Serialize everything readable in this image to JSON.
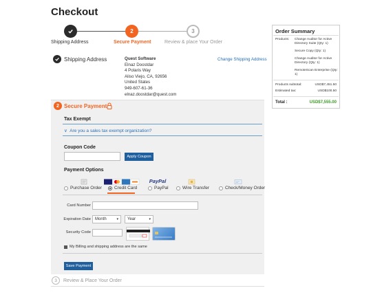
{
  "page_title": "Checkout",
  "stepper": {
    "step1_label": "Shipping Address",
    "step2_num": "2",
    "step2_label": "Secure Payment",
    "step3_num": "3",
    "step3_label": "Review & place Your Order"
  },
  "shipping": {
    "title": "Shipping Address",
    "company": "Quest Software",
    "name": "Elnaz Doostdar",
    "street": "4 Polaris Way",
    "city": "Aliso Viejo, CA, 92656",
    "country": "United States",
    "phone": "949-607-61-36",
    "email": "elnaz.doostdar@quest.com",
    "change_link": "Change Shipping Address"
  },
  "payment": {
    "num": "2",
    "title": "Secure Payment",
    "tax_exempt_heading": "Tax Exempt",
    "tax_exempt_question": "Are you a sales tax exempt organization?",
    "coupon_heading": "Coupon Code",
    "apply_coupon": "Apply Coupon",
    "options_heading": "Payment Options",
    "options": [
      "Purchase Order",
      "Credit Card",
      "PayPal",
      "Wire Transfer",
      "Check/Money Order"
    ],
    "selected_option": "Credit Card",
    "paypal_logo": "PayPal",
    "card_number_label": "Card Number",
    "expiration_label": "Expiration Date",
    "month_value": "Month",
    "year_value": "Year",
    "security_code_label": "Security Code",
    "same_address_label": "My Billing and shipping address are the same",
    "save_payment": "Save Payment"
  },
  "review": {
    "num": "3",
    "title": "Review & Place Your Order"
  },
  "summary": {
    "heading": "Order Summary",
    "products_label": "Products:",
    "products": [
      "Change Auditor for Active Directory Suite (Qty: 1)",
      "Secure Copy (Qty: 1)",
      "Change Auditor for Active Directory (Qty: 1)",
      "RemoteScan Enterprise (Qty: 1)"
    ],
    "subtotal_label": "Products subtotal:",
    "subtotal_value": "USD$7,451.50",
    "tax_label": "Estimated tax:",
    "tax_value": "USD$100.50",
    "total_label": "Total :",
    "total_value": "USD$7,555.00"
  },
  "colors": {
    "accent": "#f26422",
    "button_blue": "#1f5f9e",
    "link_blue": "#2a6fb5",
    "total_green": "#3d9a29"
  }
}
